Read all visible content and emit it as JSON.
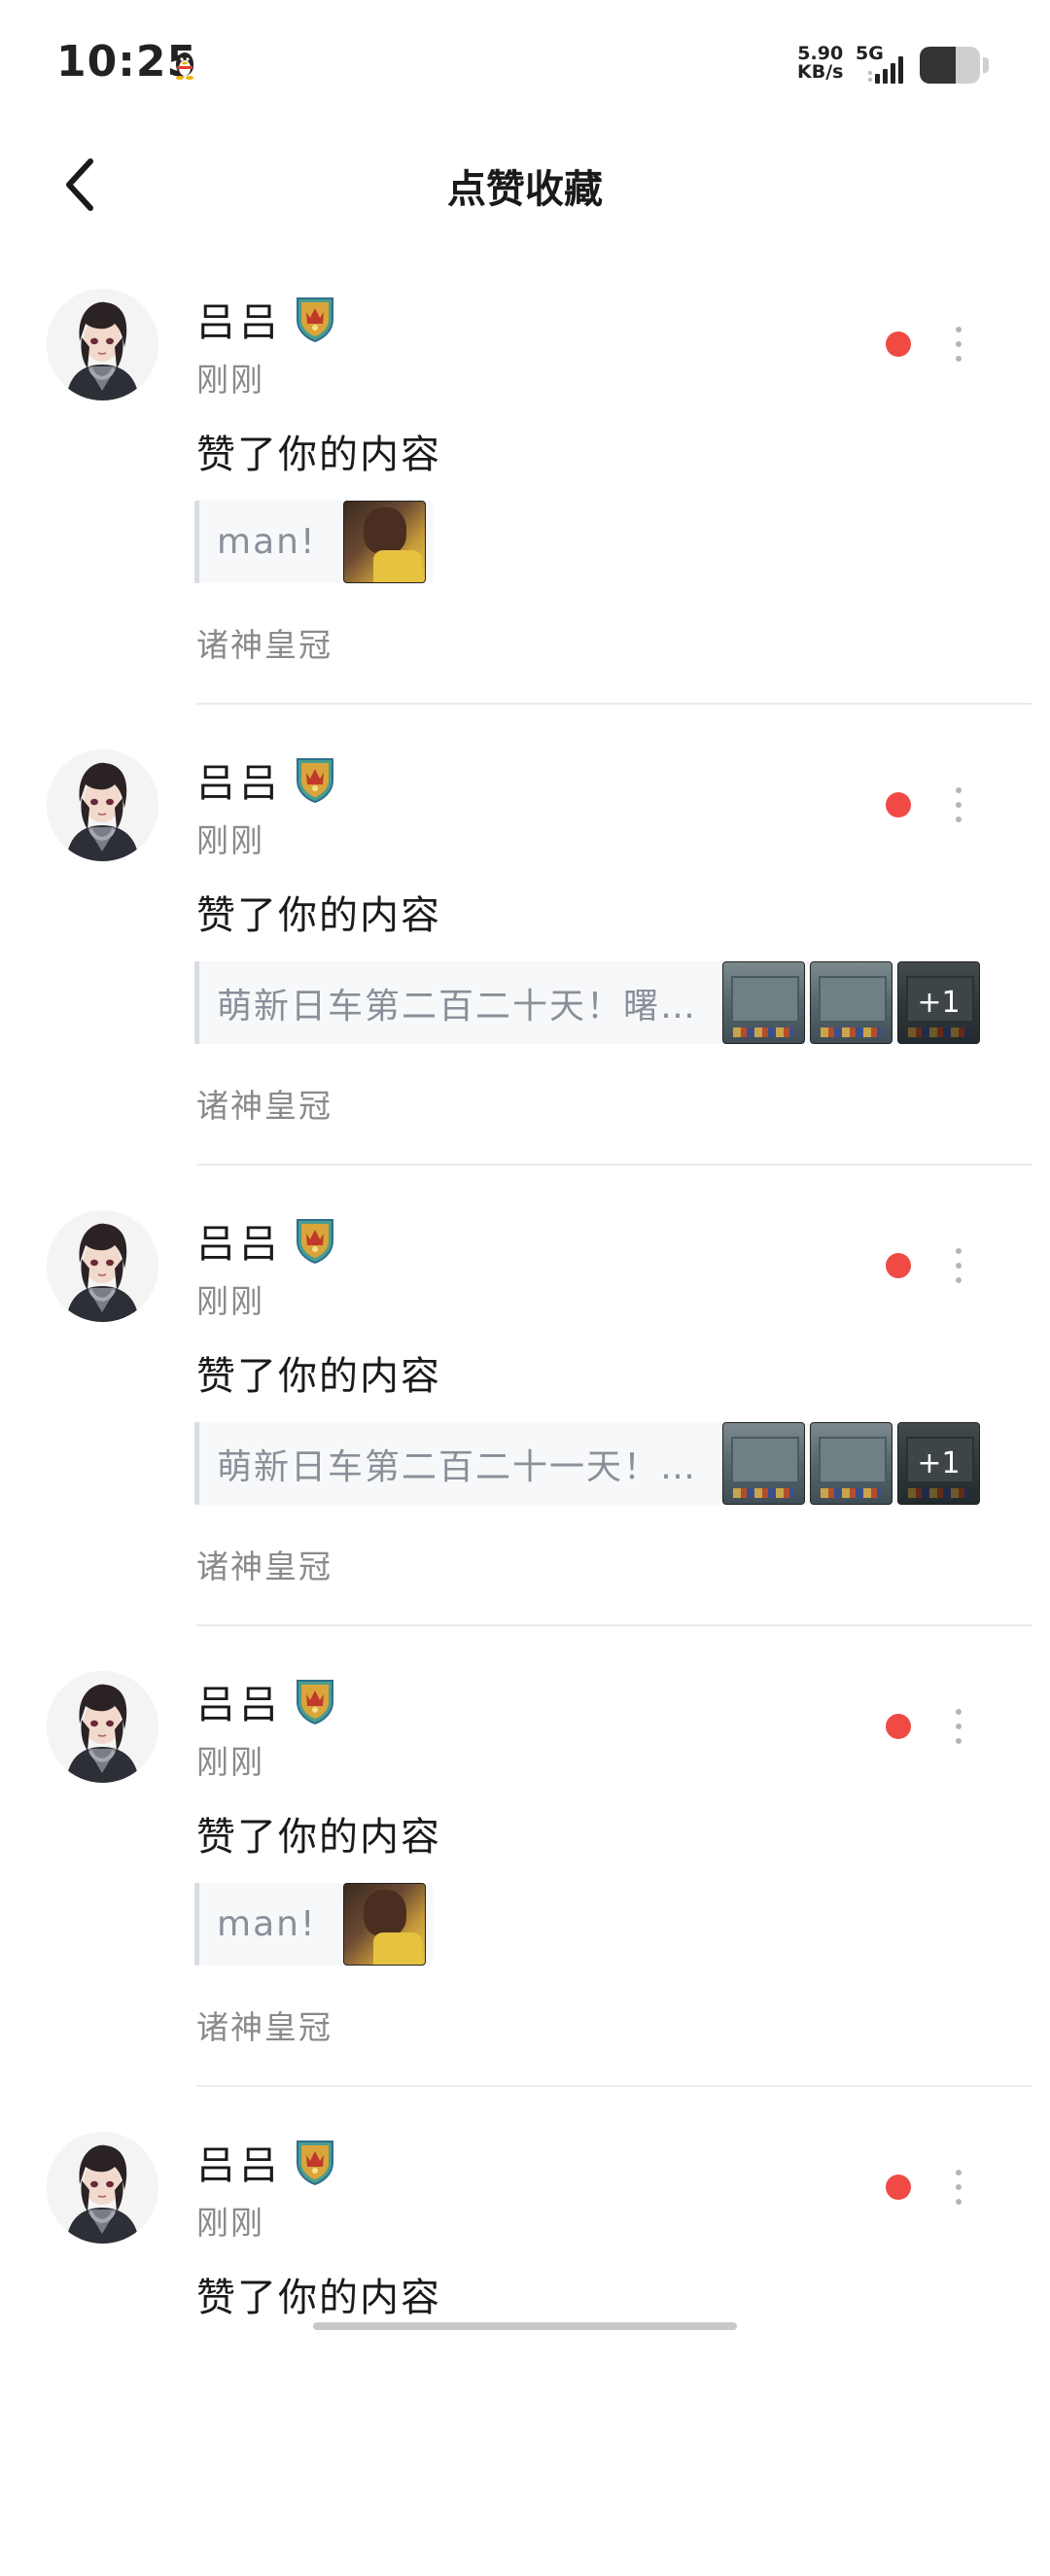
{
  "status_bar": {
    "time": "10:25",
    "net_speed_value": "5.90",
    "net_speed_unit": "KB/s",
    "network_type": "5G",
    "battery_percent": 60,
    "icons": [
      "qq-penguin-icon",
      "signal-icon",
      "battery-icon"
    ]
  },
  "nav": {
    "title": "点赞收藏",
    "back_icon": "chevron-left-icon"
  },
  "notifications": [
    {
      "user": "吕吕",
      "time": "刚刚",
      "action": "赞了你的内容",
      "quote": "man!",
      "thumbnails": [
        {
          "kind": "photo"
        }
      ],
      "more_count": "",
      "source": "诸神皇冠",
      "unread": true
    },
    {
      "user": "吕吕",
      "time": "刚刚",
      "action": "赞了你的内容",
      "quote": "萌新日车第二百二十天！曙…",
      "thumbnails": [
        {
          "kind": "game"
        },
        {
          "kind": "game"
        },
        {
          "kind": "game"
        }
      ],
      "more_count": "+1",
      "source": "诸神皇冠",
      "unread": true
    },
    {
      "user": "吕吕",
      "time": "刚刚",
      "action": "赞了你的内容",
      "quote": "萌新日车第二百二十一天！…",
      "thumbnails": [
        {
          "kind": "game"
        },
        {
          "kind": "game"
        },
        {
          "kind": "game"
        }
      ],
      "more_count": "+1",
      "source": "诸神皇冠",
      "unread": true
    },
    {
      "user": "吕吕",
      "time": "刚刚",
      "action": "赞了你的内容",
      "quote": "man!",
      "thumbnails": [
        {
          "kind": "photo"
        }
      ],
      "more_count": "",
      "source": "诸神皇冠",
      "unread": true
    },
    {
      "user": "吕吕",
      "time": "刚刚",
      "action": "赞了你的内容",
      "quote": "",
      "thumbnails": [],
      "more_count": "",
      "source": "",
      "unread": true
    }
  ],
  "colors": {
    "unread_dot": "#f04a45",
    "secondary_text": "#8a8a8a",
    "quote_background": "#f7f8fa"
  }
}
